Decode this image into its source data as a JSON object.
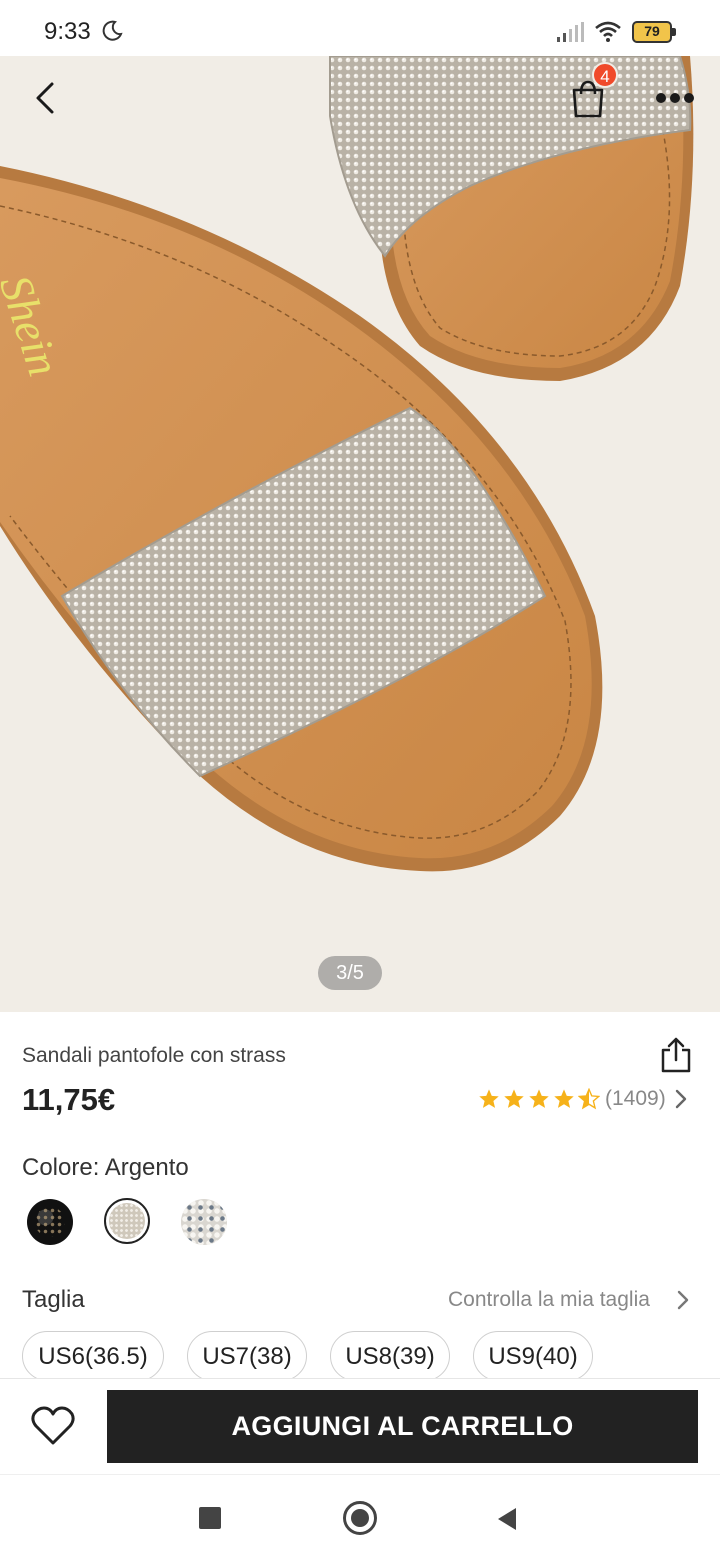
{
  "status_bar": {
    "time": "9:33",
    "battery": "79"
  },
  "product": {
    "image_counter": "3/5",
    "name": "Sandali pantofole con strass",
    "price": "11,75€",
    "rating_stars": 4.5,
    "rating_count": "(1409)",
    "brand_mark": "Shein"
  },
  "cart": {
    "badge_count": "4"
  },
  "color": {
    "label": "Colore: Argento",
    "swatches": [
      "black",
      "silver",
      "multicolor"
    ],
    "selected_index": 1
  },
  "size": {
    "label": "Taglia",
    "guide_link": "Controlla la mia taglia",
    "options": [
      "US6(36.5)",
      "US7(38)",
      "US8(39)",
      "US9(40)"
    ]
  },
  "actions": {
    "add_to_cart": "AGGIUNGI AL CARRELLO"
  },
  "colors": {
    "accent_badge": "#f04a2a",
    "star": "#f6b21a",
    "button_dark": "#222222"
  },
  "icons": [
    "moon-icon",
    "signal-icon",
    "wifi-icon",
    "battery-icon",
    "back-arrow-icon",
    "shopping-bag-icon",
    "more-icon",
    "share-icon",
    "star-icon",
    "chevron-right-icon",
    "heart-icon",
    "recents-square-icon",
    "home-circle-icon",
    "back-triangle-icon"
  ]
}
